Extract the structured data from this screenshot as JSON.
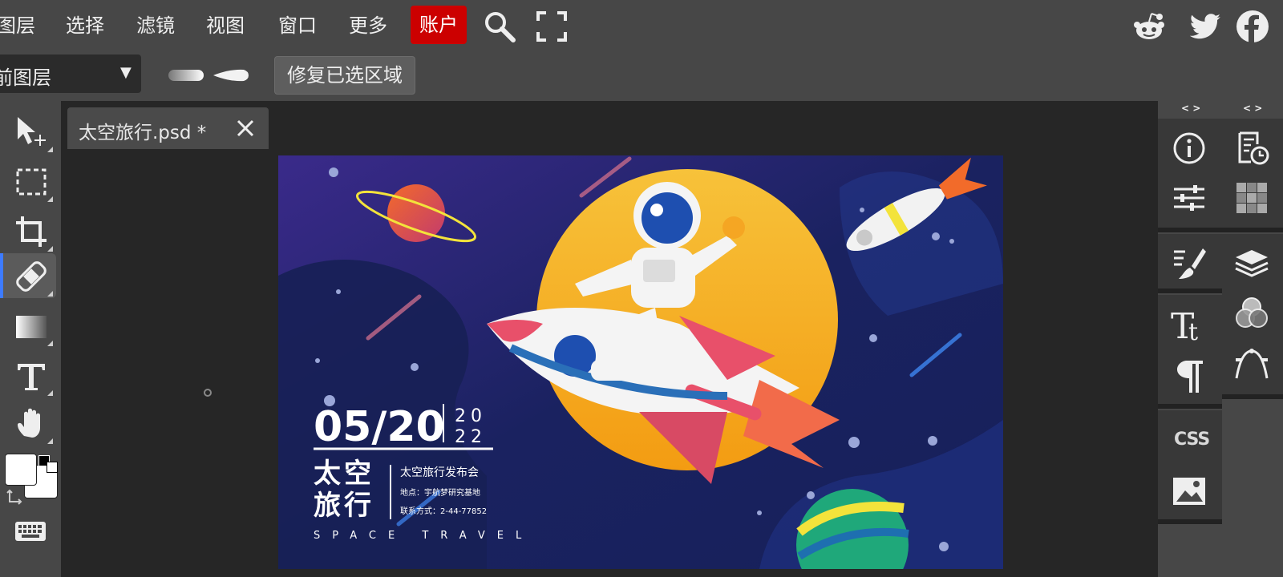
{
  "menu": {
    "items": [
      "图层",
      "选择",
      "滤镜",
      "视图",
      "窗口",
      "更多"
    ],
    "account": "账户"
  },
  "top_icons": [
    "search-icon",
    "fullscreen-icon",
    "reddit-icon",
    "twitter-icon",
    "facebook-icon"
  ],
  "options": {
    "layer_select_value": "前图层",
    "repair_button": "修复已选区域"
  },
  "document": {
    "tab_title": "太空旅行.psd *"
  },
  "poster": {
    "date": "05/20",
    "year_top": "20",
    "year_bottom": "22",
    "title_line1": "太空",
    "title_line2": "旅行",
    "event": "太空旅行发布会",
    "location": "地点：宇航梦研究基地",
    "contact": "联系方式：2-44-77852",
    "subtitle": "SPACE TRAVEL"
  },
  "right_panel": {
    "collapse_label": "< >",
    "css_label": "CSS"
  },
  "colors": {
    "accent_blue": "#3d7bff",
    "account_red": "#cc0000",
    "poster_bg": "#1a2260",
    "moon": "#f7b733"
  }
}
